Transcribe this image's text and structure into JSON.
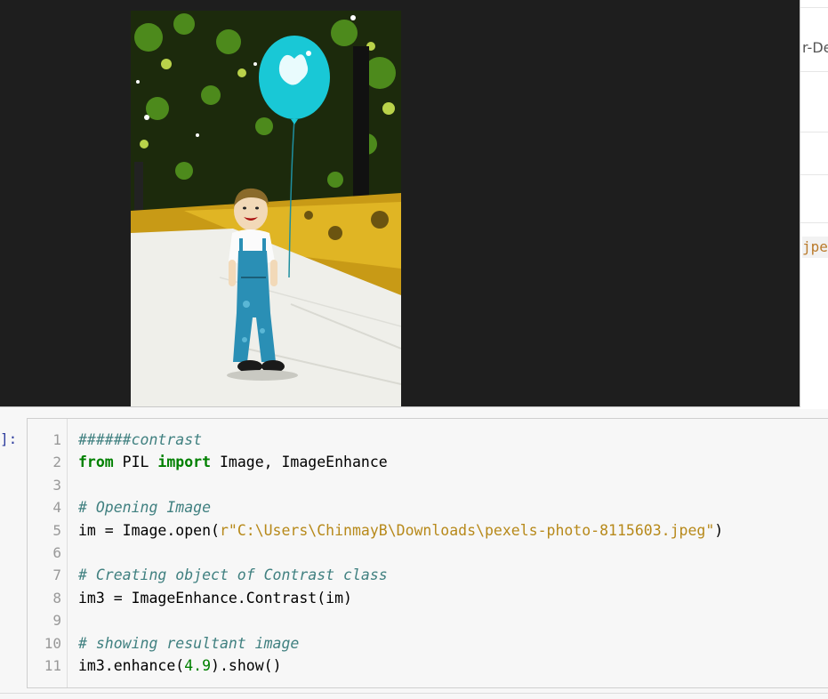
{
  "background_panel": {
    "partial_text_top": "r-De",
    "partial_text_code": "jpe"
  },
  "image_viewer": {
    "image_description": "high-contrast photo: toddler in denim overalls holding a cyan balloon on a park path"
  },
  "cell": {
    "prompt": "]:",
    "lines": [
      {
        "n": "1",
        "text": "######contrast"
      },
      {
        "n": "2",
        "text": "from PIL import Image, ImageEnhance"
      },
      {
        "n": "3",
        "text": ""
      },
      {
        "n": "4",
        "text": "# Opening Image"
      },
      {
        "n": "5",
        "text": "im = Image.open(r\"C:\\Users\\ChinmayB\\Downloads\\pexels-photo-8115603.jpeg\")"
      },
      {
        "n": "6",
        "text": ""
      },
      {
        "n": "7",
        "text": "# Creating object of Contrast class"
      },
      {
        "n": "8",
        "text": "im3 = ImageEnhance.Contrast(im)"
      },
      {
        "n": "9",
        "text": ""
      },
      {
        "n": "10",
        "text": "# showing resultant image"
      },
      {
        "n": "11",
        "text": "im3.enhance(4.9).show()"
      }
    ],
    "tokens": {
      "l1_comment": "######contrast",
      "l2_from": "from",
      "l2_mid": " PIL ",
      "l2_import": "import",
      "l2_rest": " Image, ImageEnhance",
      "l4_comment": "# Opening Image",
      "l5_pre": "im = Image.open(",
      "l5_str": "r\"C:\\Users\\ChinmayB\\Downloads\\pexels-photo-8115603.jpeg\"",
      "l5_post": ")",
      "l7_comment": "# Creating object of Contrast class",
      "l8_code": "im3 = ImageEnhance.Contrast(im)",
      "l10_comment": "# showing resultant image",
      "l11_pre": "im3.enhance(",
      "l11_num": "4.9",
      "l11_post": ").show()"
    }
  },
  "colors": {
    "viewer_bg": "#1e1e1e",
    "keyword": "#008000",
    "comment": "#408080",
    "string": "#b7891a"
  }
}
